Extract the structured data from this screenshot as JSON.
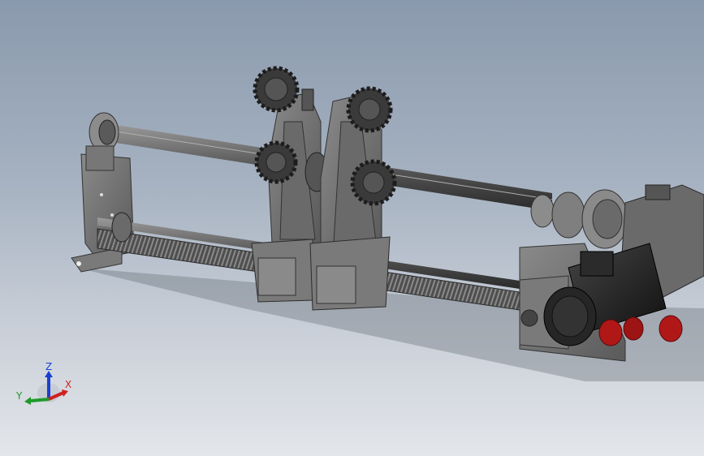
{
  "viewport": {
    "background_top": "#8a99ad",
    "background_bottom": "#e3e6ea"
  },
  "model": {
    "parts": [
      "left-bearing-support",
      "upper-guide-shaft",
      "lower-lead-screw",
      "sprocket-bracket-1",
      "sprocket-bracket-2",
      "sliding-block-1",
      "sliding-block-2",
      "right-bearing-support",
      "coupling",
      "gear-reducer",
      "electric-motor",
      "red-brake-components"
    ],
    "colors": {
      "steel": "#6f6f6f",
      "dark_steel": "#3c3c3c",
      "motor_black": "#1e1e1e",
      "brake_red": "#b01818"
    }
  },
  "triad": {
    "x_label": "X",
    "y_label": "Y",
    "z_label": "Z",
    "x_color": "#d02020",
    "y_color": "#1f9a2a",
    "z_color": "#1a3fd0"
  }
}
